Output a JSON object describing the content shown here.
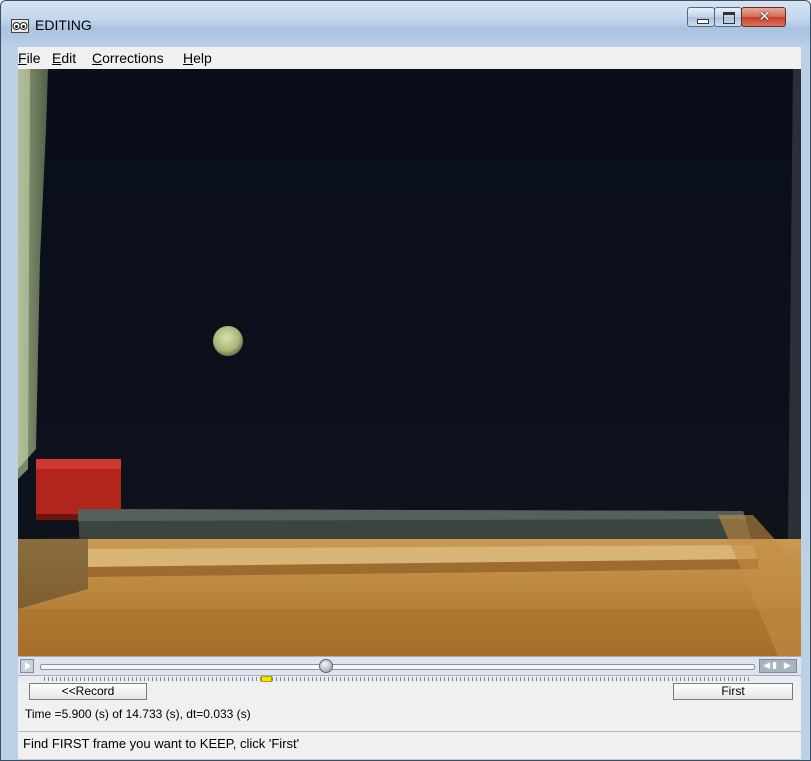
{
  "window": {
    "title": "EDITING"
  },
  "menu": {
    "items": [
      {
        "accel": "F",
        "rest": "ile"
      },
      {
        "accel": "E",
        "rest": "dit"
      },
      {
        "accel": "C",
        "rest": "orrections"
      },
      {
        "accel": "H",
        "rest": "elp"
      }
    ]
  },
  "controls": {
    "close_glyph": "✕",
    "step_glyph": "◀▮ ▶"
  },
  "playback": {
    "position_fraction": 0.4005
  },
  "buttons": {
    "record": "<<Record",
    "first": "First"
  },
  "time_readout": "Time =5.900 (s) of 14.733 (s), dt=0.033 (s)",
  "status": "Find FIRST frame you want to KEEP, click 'First'",
  "colors": {
    "video_bg": "#0b0f1c",
    "frame_marker": "#f4e400"
  }
}
